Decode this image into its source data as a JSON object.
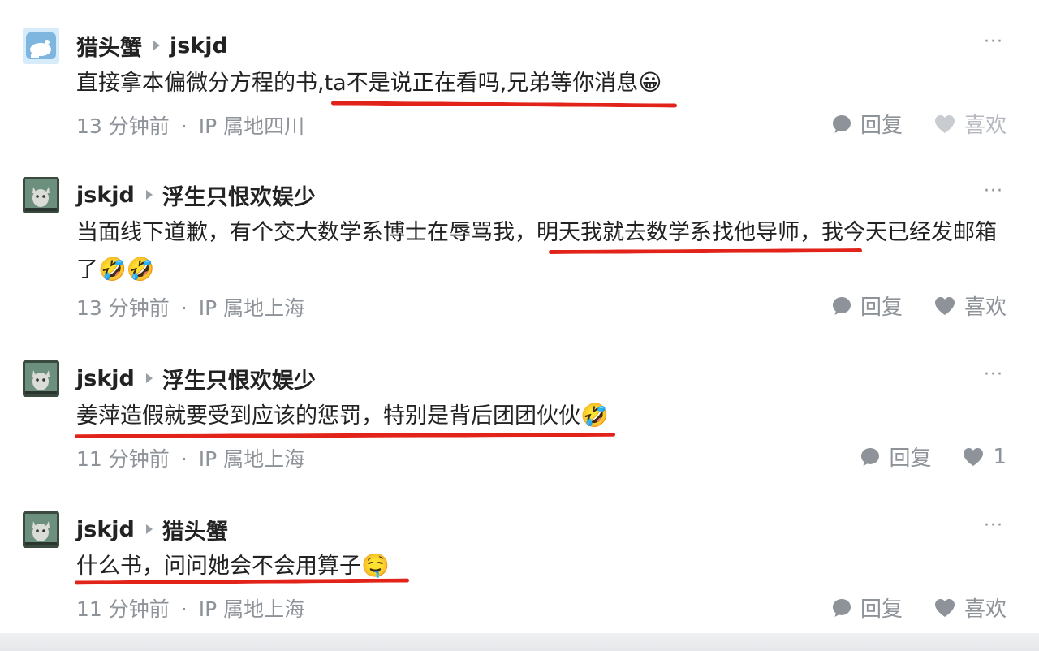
{
  "comments": [
    {
      "author": "猎头蟹",
      "reply_to": "jskjd",
      "text": "直接拿本偏微分方程的书,ta不是说正在看吗,兄弟等你消息",
      "emoji": "😀",
      "time": "13 分钟前",
      "location": "IP 属地四川",
      "reply_label": "回复",
      "like_label": "喜欢"
    },
    {
      "author": "jskjd",
      "reply_to": "浮生只恨欢娱少",
      "text": "当面线下道歉，有个交大数学系博士在辱骂我，明天我就去数学系找他导师，我今天已经发邮箱了",
      "emoji": "🤣🤣",
      "time": "13 分钟前",
      "location": "IP 属地上海",
      "reply_label": "回复",
      "like_label": "喜欢"
    },
    {
      "author": "jskjd",
      "reply_to": "浮生只恨欢娱少",
      "text": "姜萍造假就要受到应该的惩罚，特别是背后团团伙伙",
      "emoji": "🤣",
      "time": "11 分钟前",
      "location": "IP 属地上海",
      "reply_label": "回复",
      "like_label": "1"
    },
    {
      "author": "jskjd",
      "reply_to": "猎头蟹",
      "text": "什么书，问问她会不会用算子",
      "emoji": "🤤",
      "time": "11 分钟前",
      "location": "IP 属地上海",
      "reply_label": "回复",
      "like_label": "喜欢"
    }
  ],
  "more_label": "···",
  "meta_separator": "·",
  "colors": {
    "underline": "#e2231a",
    "meta_text": "#8e9399",
    "avatar_bird_bg": "#7fb6e0",
    "avatar_dark_bg": "#3a4a3f"
  },
  "icons": {
    "reply": "speech-bubble-icon",
    "like": "heart-icon",
    "more": "more-dots-icon",
    "reply_arrow": "caret-right-icon"
  }
}
